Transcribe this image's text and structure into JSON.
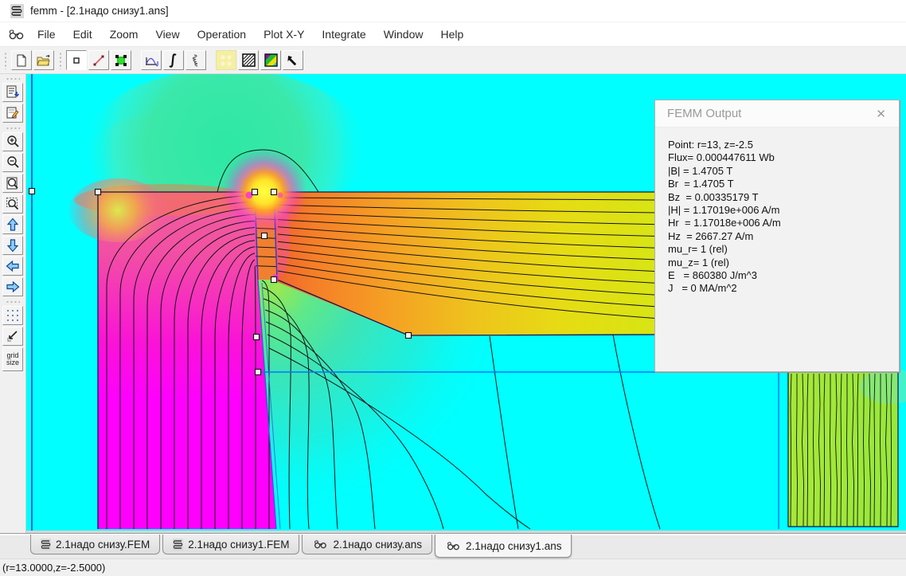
{
  "window": {
    "title": "femm - [2.1надо снизу1.ans]"
  },
  "menu": {
    "items": [
      "File",
      "Edit",
      "Zoom",
      "View",
      "Operation",
      "Plot X-Y",
      "Integrate",
      "Window",
      "Help"
    ]
  },
  "toolbar": {
    "icons": [
      "new-file",
      "open-file",
      "point-mode",
      "contour-line-mode",
      "block-mode",
      "plot-graph",
      "line-integral",
      "coil-properties",
      "show-mesh",
      "contour-plot",
      "density-plot",
      "vector-plot"
    ]
  },
  "sidebar": {
    "icons": [
      "output-window",
      "edit-document",
      "zoom-in",
      "zoom-out",
      "zoom-extents",
      "zoom-window",
      "pan-up",
      "pan-down",
      "pan-left",
      "pan-right",
      "grid-dots",
      "snap-to-grid"
    ],
    "grid_size_line1": "grid",
    "grid_size_line2": "size"
  },
  "output_panel": {
    "title": "FEMM Output",
    "close_glyph": "✕",
    "lines": [
      "Point: r=13, z=-2.5",
      "Flux= 0.000447611 Wb",
      "|B| = 1.4705 T",
      "Br  = 1.4705 T",
      "Bz  = 0.00335179 T",
      "|H| = 1.17019e+006 A/m",
      "Hr  = 1.17018e+006 A/m",
      "Hz  = 2667.27 A/m",
      "mu_r= 1 (rel)",
      "mu_z= 1 (rel)",
      "E   = 860380 J/m^3",
      "J   = 0 MA/m^2"
    ]
  },
  "tabs": [
    {
      "icon": "coil",
      "label": "2.1надо снизу.FEM",
      "active": false
    },
    {
      "icon": "coil",
      "label": "2.1надо снизу1.FEM",
      "active": false
    },
    {
      "icon": "glasses",
      "label": "2.1надо снизу.ans",
      "active": false
    },
    {
      "icon": "glasses",
      "label": "2.1надо снизу1.ans",
      "active": true
    }
  ],
  "statusbar": {
    "text": "(r=13.0000,z=-2.5000)"
  },
  "plot": {
    "colors": {
      "background": "#00FFFF",
      "magnet_low": "#FF00FF",
      "magnet_high": "#F2559E",
      "gap_orange": "#F08030",
      "band_left": "#F0662C",
      "band_right": "#ACE832",
      "blob_teal": "#3CE8A8",
      "glow_yellow": "#FFFF40",
      "boundary_blue": "#141452",
      "selection_blue": "#0076FF",
      "flux_line": "#141414"
    }
  }
}
